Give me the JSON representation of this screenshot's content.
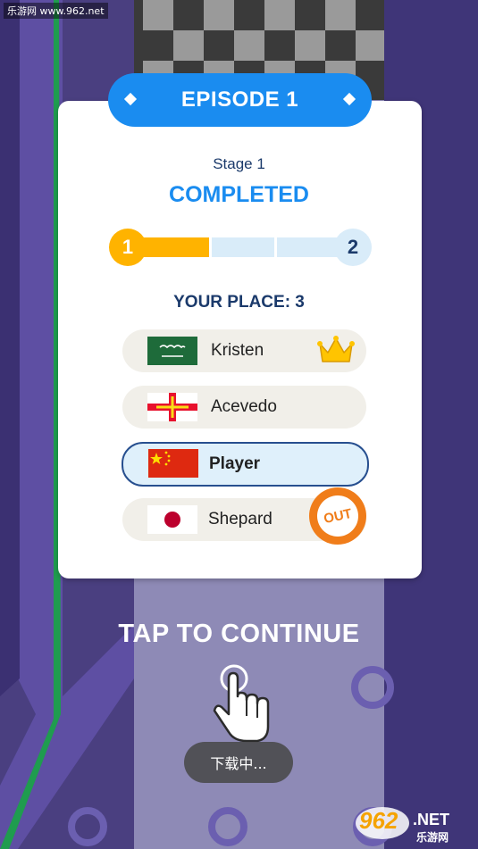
{
  "watermark": "乐游网 www.962.net",
  "banner": {
    "title": "EPISODE 1"
  },
  "stage": {
    "label": "Stage 1",
    "status": "COMPLETED"
  },
  "progress": {
    "current_stage": "1",
    "next_stage": "2",
    "fraction_completed": 0.33
  },
  "standings": {
    "title": "YOUR PLACE: 3",
    "entries": [
      {
        "name": "Kristen",
        "flag": "saudi-arabia",
        "badge": "crown-icon"
      },
      {
        "name": "Acevedo",
        "flag": "guernsey",
        "badge": ""
      },
      {
        "name": "Player",
        "flag": "china",
        "badge": "",
        "highlighted": true
      },
      {
        "name": "Shepard",
        "flag": "japan",
        "badge": "out-badge",
        "out_label": "OUT"
      }
    ]
  },
  "tap_label": "TAP TO CONTINUE",
  "toast": "下载中...",
  "logo": {
    "number": "962",
    "suffix": ".NET",
    "subtitle": "乐游网"
  },
  "colors": {
    "accent": "#1a8cf0",
    "progress": "#ffb300",
    "navy": "#1b3a6b",
    "track": "#5a4d93",
    "out": "#f07d1a"
  }
}
